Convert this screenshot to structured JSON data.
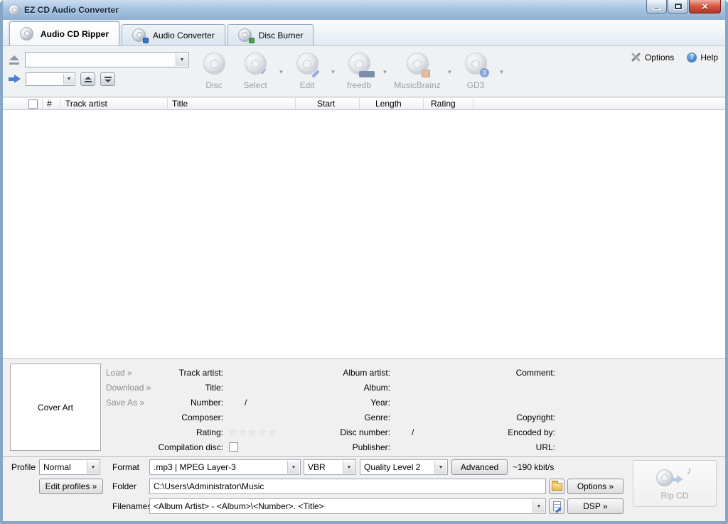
{
  "window": {
    "title": "EZ CD Audio Converter"
  },
  "tabs": {
    "items": [
      {
        "label": "Audio CD Ripper",
        "active": true
      },
      {
        "label": "Audio Converter",
        "active": false
      },
      {
        "label": "Disc Burner",
        "active": false
      }
    ]
  },
  "toolbar": {
    "drive_select_value": "",
    "speed_select_value": "",
    "buttons": [
      {
        "label": "Disc",
        "has_dropdown": false
      },
      {
        "label": "Select",
        "has_dropdown": true
      },
      {
        "label": "Edit",
        "has_dropdown": true
      },
      {
        "label": "freedb",
        "has_dropdown": true
      },
      {
        "label": "MusicBrainz",
        "has_dropdown": true
      },
      {
        "label": "GD3",
        "has_dropdown": true
      }
    ],
    "options_label": "Options",
    "help_label": "Help"
  },
  "track_table": {
    "columns": [
      "#",
      "Track artist",
      "Title",
      "Start",
      "Length",
      "Rating"
    ],
    "rows": []
  },
  "metadata": {
    "cover_art_label": "Cover Art",
    "links": [
      {
        "label": "Load »"
      },
      {
        "label": "Download »"
      },
      {
        "label": "Save As »"
      }
    ],
    "labels": {
      "track_artist": "Track artist:",
      "title": "Title:",
      "number": "Number:",
      "number_sep": "/",
      "composer": "Composer:",
      "rating": "Rating:",
      "compilation": "Compilation disc:",
      "album_artist": "Album artist:",
      "album": "Album:",
      "year": "Year:",
      "genre": "Genre:",
      "disc_number": "Disc number:",
      "disc_sep": "/",
      "publisher": "Publisher:",
      "comment": "Comment:",
      "copyright": "Copyright:",
      "encoded_by": "Encoded by:",
      "url": "URL:"
    },
    "rating_stars": "☆☆☆☆☆"
  },
  "output": {
    "profile_label": "Profile",
    "profile_value": "Normal",
    "edit_profiles_label": "Edit profiles »",
    "format_label": "Format",
    "format_value": ".mp3 | MPEG Layer-3",
    "bitrate_mode_value": "VBR",
    "quality_value": "Quality Level 2",
    "advanced_label": "Advanced",
    "bitrate_info": "~190 kbit/s",
    "folder_label": "Folder",
    "folder_value": "C:\\Users\\Administrator\\Music",
    "options_label": "Options »",
    "filenames_label": "Filenames",
    "filenames_value": "<Album Artist> - <Album>\\<Number>. <Title>",
    "dsp_label": "DSP »",
    "rip_cd_label": "Rip CD"
  }
}
